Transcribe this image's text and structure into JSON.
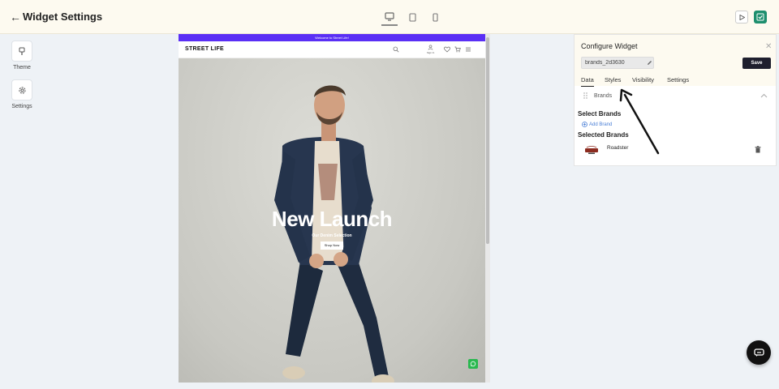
{
  "header": {
    "title": "Widget Settings",
    "back_icon": "arrow-left-icon",
    "devices": [
      "desktop-icon",
      "tablet-icon",
      "mobile-icon"
    ]
  },
  "rail": {
    "items": [
      {
        "label": "Theme",
        "icon": "brush-icon"
      },
      {
        "label": "Settings",
        "icon": "gear-icon"
      }
    ]
  },
  "preview": {
    "announcement": "Welcome to Street Life!",
    "logo": "STREET LIFE",
    "sign_in": "Sign In",
    "hero_title": "New Launch",
    "hero_subtitle": "Our Denim Selection",
    "cta": "Shop Now"
  },
  "panel": {
    "title": "Configure Widget",
    "widget_name": "brands_2d3630",
    "save": "Save",
    "tabs": [
      "Data",
      "Styles",
      "Visibility",
      "Settings"
    ],
    "active_tab": "Data",
    "section": "Brands",
    "select_title": "Select Brands",
    "add_brand": "Add Brand",
    "selected_title": "Selected Brands",
    "brands": [
      {
        "name": "Roadster"
      }
    ]
  },
  "colors": {
    "announcement_bar": "#5a2ff5",
    "save_button": "#1f1f2e",
    "publish_button": "#1e8f6e",
    "link": "#4a7fd6"
  }
}
